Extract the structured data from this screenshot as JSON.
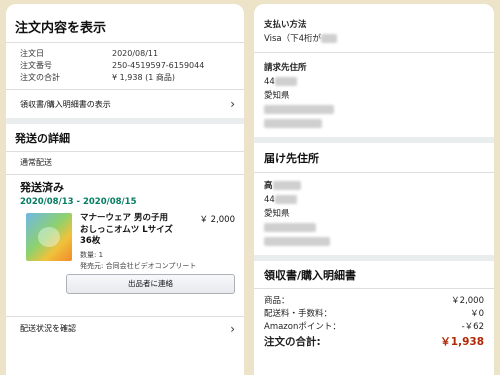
{
  "left": {
    "order_summary": {
      "title": "注文内容を表示",
      "rows": [
        {
          "label": "注文日",
          "value": "2020/08/11"
        },
        {
          "label": "注文番号",
          "value": "250-4519597-6159044"
        },
        {
          "label": "注文の合計",
          "value": "¥ 1,938 (1 商品)"
        }
      ],
      "receipt_link": "領収書/購入明細書の表示"
    },
    "shipping": {
      "title": "発送の詳細",
      "method": "通常配送",
      "status": "発送済み",
      "dates": "2020/08/13 - 2020/08/15",
      "item": {
        "name": "マナーウェア 男の子用おしっこオムツ Lサイズ 36枚",
        "price": "￥ 2,000",
        "quantity": "数量: 1",
        "seller": "発売元: 合同会社ビデオコンプリート"
      },
      "contact_button": "出品者に連絡",
      "track_link": "配送状況を確認"
    }
  },
  "right": {
    "payment": {
      "title": "支払い方法",
      "card": "Visa（下4桁が"
    },
    "billing": {
      "title": "請求先住所",
      "line1": "44",
      "line2": "愛知県"
    },
    "shipping_address": {
      "title": "届け先住所",
      "line0": "高",
      "line1": "44",
      "line2": "愛知県"
    },
    "receipt": {
      "title": "領収書/購入明細書",
      "rows": [
        {
          "label": "商品：",
          "value": "￥2,000"
        },
        {
          "label": "配送料・手数料：",
          "value": "￥0"
        },
        {
          "label": "Amazonポイント：",
          "value": "-￥62"
        }
      ],
      "total_label": "注文の合計:",
      "total_value": "￥1,938"
    }
  },
  "icons": {
    "chevron": "chevron-right-icon"
  },
  "colors": {
    "green": "#067d62",
    "price_red": "#b12704"
  }
}
